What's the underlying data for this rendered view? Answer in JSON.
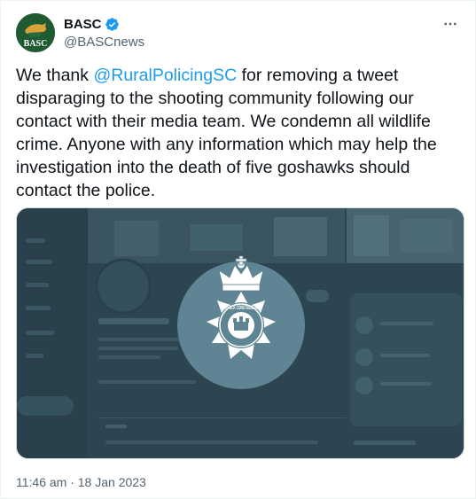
{
  "author": {
    "display_name": "BASC",
    "handle": "@BASCnews",
    "avatar_text": "BASC",
    "verified": true,
    "avatar_color": "#1f5a33"
  },
  "tweet": {
    "text_before": "We thank ",
    "mention": "@RuralPolicingSC",
    "text_after": " for removing a tweet disparaging to the shooting community following our contact with their media team. We condemn all wildlife crime. Anyone with any information which may help the investigation into the death of five goshawks should contact the police.",
    "timestamp": "11:46 am · 18 Jan 2023"
  },
  "media": {
    "description_icon": "suffolk-constabulary-crest",
    "crest_text": "SUFFOLK CONSTABULARY"
  },
  "icons": {
    "more": "more-horizontal-icon",
    "verified": "verified-badge-icon"
  },
  "colors": {
    "link": "#1d9bf0",
    "secondary_text": "#536471",
    "crest_circle": "#5f8494",
    "media_bg": "#2f4651"
  }
}
